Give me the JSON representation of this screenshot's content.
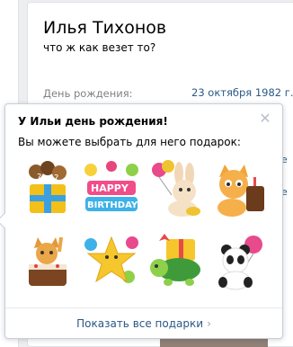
{
  "profile": {
    "name": "Илья Тихонов",
    "status": "что ж как везет то?",
    "birthday_label": "День рождения:",
    "birthday_value": "23 октября 1982 г."
  },
  "edge_fragments": {
    "frag1": "е",
    "frag2": "е"
  },
  "popup": {
    "title": "У Ильи день рождения!",
    "subtitle": "Вы можете выбрать для него подарок:",
    "close_icon": "close-icon",
    "show_all_label": "Показать все подарки",
    "show_all_icon": "chevron-right-icon"
  },
  "gifts": [
    {
      "name": "gift-box-balloons"
    },
    {
      "name": "happy-birthday-letters"
    },
    {
      "name": "bunny-balloons"
    },
    {
      "name": "cat-cake"
    },
    {
      "name": "cat-in-cake"
    },
    {
      "name": "star-balloons"
    },
    {
      "name": "turtle-present"
    },
    {
      "name": "panda-balloon"
    }
  ],
  "colors": {
    "link": "#2a5885",
    "muted": "#828282",
    "border": "#c5d0db",
    "background": "#edeef0"
  }
}
